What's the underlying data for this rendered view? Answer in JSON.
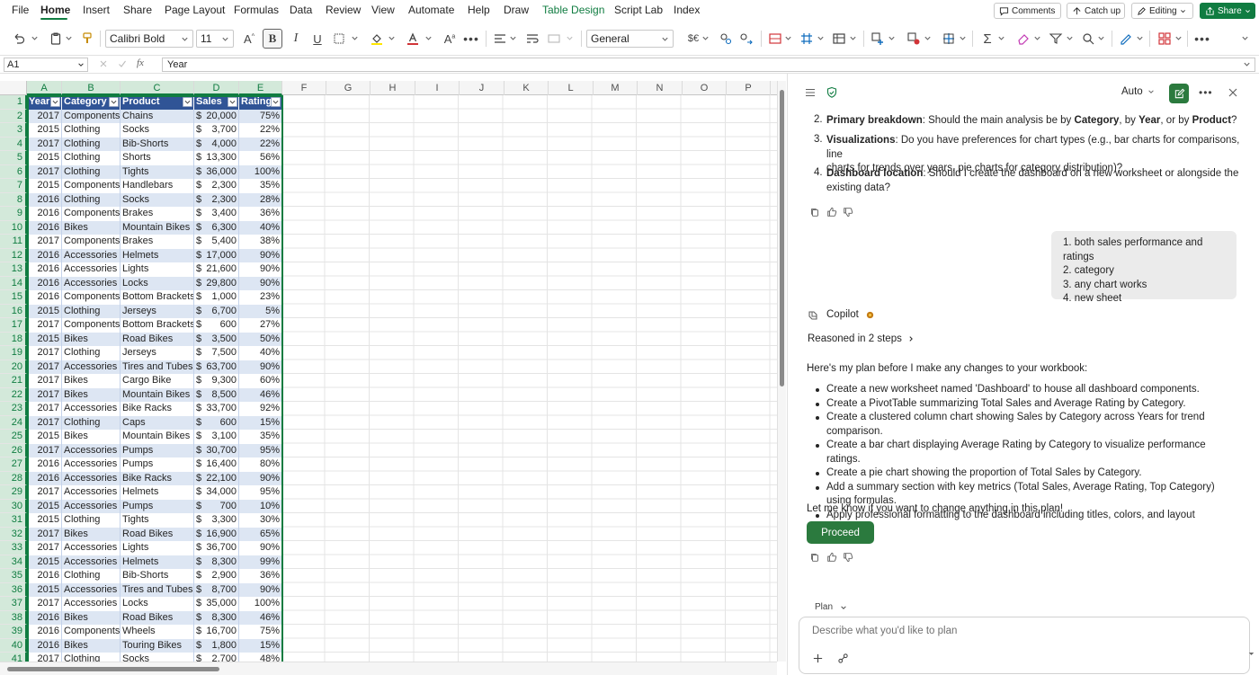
{
  "menu": {
    "items": [
      "File",
      "Home",
      "Insert",
      "Share",
      "Page Layout",
      "Formulas",
      "Data",
      "Review",
      "View",
      "Automate",
      "Help",
      "Draw",
      "Table Design",
      "Script Lab",
      "Index"
    ],
    "active": "Home",
    "comments": "Comments",
    "catchup": "Catch up",
    "editing": "Editing",
    "share": "Share"
  },
  "ribbon": {
    "font_name": "Calibri Bold",
    "font_size": "11",
    "number_format": "General",
    "currency": "$€"
  },
  "formula_bar": {
    "cell_ref": "A1",
    "fx": "fx",
    "value": "Year"
  },
  "sheet": {
    "columns": [
      "A",
      "B",
      "C",
      "D",
      "E",
      "F",
      "G",
      "H",
      "I",
      "J",
      "K",
      "L",
      "M",
      "N",
      "O",
      "P"
    ],
    "header": [
      "Year",
      "Category",
      "Product",
      "Sales",
      "Rating"
    ],
    "rows": [
      [
        "2017",
        "Components",
        "Chains",
        "$",
        "20,000",
        "75%"
      ],
      [
        "2015",
        "Clothing",
        "Socks",
        "$",
        "3,700",
        "22%"
      ],
      [
        "2017",
        "Clothing",
        "Bib-Shorts",
        "$",
        "4,000",
        "22%"
      ],
      [
        "2015",
        "Clothing",
        "Shorts",
        "$",
        "13,300",
        "56%"
      ],
      [
        "2017",
        "Clothing",
        "Tights",
        "$",
        "36,000",
        "100%"
      ],
      [
        "2015",
        "Components",
        "Handlebars",
        "$",
        "2,300",
        "35%"
      ],
      [
        "2016",
        "Clothing",
        "Socks",
        "$",
        "2,300",
        "28%"
      ],
      [
        "2016",
        "Components",
        "Brakes",
        "$",
        "3,400",
        "36%"
      ],
      [
        "2016",
        "Bikes",
        "Mountain Bikes",
        "$",
        "6,300",
        "40%"
      ],
      [
        "2017",
        "Components",
        "Brakes",
        "$",
        "5,400",
        "38%"
      ],
      [
        "2016",
        "Accessories",
        "Helmets",
        "$",
        "17,000",
        "90%"
      ],
      [
        "2016",
        "Accessories",
        "Lights",
        "$",
        "21,600",
        "90%"
      ],
      [
        "2016",
        "Accessories",
        "Locks",
        "$",
        "29,800",
        "90%"
      ],
      [
        "2016",
        "Components",
        "Bottom Brackets",
        "$",
        "1,000",
        "23%"
      ],
      [
        "2015",
        "Clothing",
        "Jerseys",
        "$",
        "6,700",
        "5%"
      ],
      [
        "2017",
        "Components",
        "Bottom Brackets",
        "$",
        "600",
        "27%"
      ],
      [
        "2015",
        "Bikes",
        "Road Bikes",
        "$",
        "3,500",
        "50%"
      ],
      [
        "2017",
        "Clothing",
        "Jerseys",
        "$",
        "7,500",
        "40%"
      ],
      [
        "2017",
        "Accessories",
        "Tires and Tubes",
        "$",
        "63,700",
        "90%"
      ],
      [
        "2017",
        "Bikes",
        "Cargo Bike",
        "$",
        "9,300",
        "60%"
      ],
      [
        "2017",
        "Bikes",
        "Mountain Bikes",
        "$",
        "8,500",
        "46%"
      ],
      [
        "2017",
        "Accessories",
        "Bike Racks",
        "$",
        "33,700",
        "92%"
      ],
      [
        "2017",
        "Clothing",
        "Caps",
        "$",
        "600",
        "15%"
      ],
      [
        "2015",
        "Bikes",
        "Mountain Bikes",
        "$",
        "3,100",
        "35%"
      ],
      [
        "2017",
        "Accessories",
        "Pumps",
        "$",
        "30,700",
        "95%"
      ],
      [
        "2016",
        "Accessories",
        "Pumps",
        "$",
        "16,400",
        "80%"
      ],
      [
        "2016",
        "Accessories",
        "Bike Racks",
        "$",
        "22,100",
        "90%"
      ],
      [
        "2017",
        "Accessories",
        "Helmets",
        "$",
        "34,000",
        "95%"
      ],
      [
        "2015",
        "Accessories",
        "Pumps",
        "$",
        "700",
        "10%"
      ],
      [
        "2015",
        "Clothing",
        "Tights",
        "$",
        "3,300",
        "30%"
      ],
      [
        "2017",
        "Bikes",
        "Road Bikes",
        "$",
        "16,900",
        "65%"
      ],
      [
        "2017",
        "Accessories",
        "Lights",
        "$",
        "36,700",
        "90%"
      ],
      [
        "2015",
        "Accessories",
        "Helmets",
        "$",
        "8,300",
        "99%"
      ],
      [
        "2016",
        "Clothing",
        "Bib-Shorts",
        "$",
        "2,900",
        "36%"
      ],
      [
        "2015",
        "Accessories",
        "Tires and Tubes",
        "$",
        "8,700",
        "90%"
      ],
      [
        "2017",
        "Accessories",
        "Locks",
        "$",
        "35,000",
        "100%"
      ],
      [
        "2016",
        "Bikes",
        "Road Bikes",
        "$",
        "8,300",
        "46%"
      ],
      [
        "2016",
        "Components",
        "Wheels",
        "$",
        "16,700",
        "75%"
      ],
      [
        "2016",
        "Bikes",
        "Touring Bikes",
        "$",
        "1,800",
        "15%"
      ],
      [
        "2017",
        "Clothing",
        "Socks",
        "$",
        "2,700",
        "48%"
      ]
    ]
  },
  "copilot": {
    "mode": "Auto",
    "questions": [
      {
        "num": "2.",
        "bold": "Primary breakdown",
        "line1": ": Should the main analysis be by ",
        "b1": "Category",
        "t1": ", by ",
        "b2": "Year",
        "t2": ", or by ",
        "b3": "Product",
        "t3": "?"
      },
      {
        "num": "3.",
        "bold": "Visualizations",
        "line1": ": Do you have preferences for chart types (e.g., bar charts for comparisons, line",
        "line2": "charts for trends over years, pie charts for category distribution)?"
      },
      {
        "num": "4.",
        "bold": "Dashboard location",
        "line1": ": Should I create the dashboard on a new worksheet or alongside the",
        "line2": "existing data?"
      }
    ],
    "user_reply": [
      "1. both sales performance and ratings",
      "2. category",
      "3. any chart works",
      "4. new sheet"
    ],
    "agent_name": "Copilot",
    "reasoned": "Reasoned in 2 steps",
    "plan_intro": "Here's my plan before I make any changes to your workbook:",
    "plan_items": [
      "Create a new worksheet named 'Dashboard' to house all dashboard components.",
      "Create a PivotTable summarizing Total Sales and Average Rating by Category.",
      "Create a clustered column chart showing Sales by Category across Years for trend comparison.",
      "Create a bar chart displaying Average Rating by Category to visualize performance ratings.",
      "Create a pie chart showing the proportion of Total Sales by Category.",
      "Add a summary section with key metrics (Total Sales, Average Rating, Top Category) using formulas.",
      "Apply professional formatting to the dashboard including titles, colors, and layout alignment."
    ],
    "plan_outro": "Let me know if you want to change anything in this plan!",
    "proceed": "Proceed",
    "composer_mode": "Plan",
    "composer_placeholder": "Describe what you'd like to plan"
  },
  "colors": {
    "accent": "#107c41",
    "table_header": "#305496",
    "table_band": "#dde6f3",
    "proceed": "#2b7a3e"
  }
}
